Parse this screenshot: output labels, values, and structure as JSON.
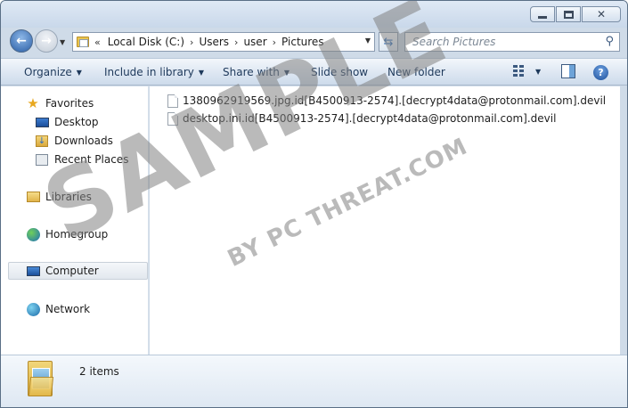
{
  "address": {
    "crumbs": [
      "Local Disk (C:)",
      "Users",
      "user",
      "Pictures"
    ],
    "overflow_glyph": "«"
  },
  "search": {
    "placeholder": "Search Pictures"
  },
  "toolbar": {
    "organize": "Organize",
    "include_in_library": "Include in library",
    "share_with": "Share with",
    "slide_show": "Slide show",
    "new_folder": "New folder"
  },
  "nav": {
    "favorites": "Favorites",
    "desktop": "Desktop",
    "downloads": "Downloads",
    "recent_places": "Recent Places",
    "libraries": "Libraries",
    "homegroup": "Homegroup",
    "computer": "Computer",
    "network": "Network"
  },
  "files": [
    {
      "name": "1380962919569.jpg.id[B4500913-2574].[decrypt4data@protonmail.com].devil"
    },
    {
      "name": "desktop.ini.id[B4500913-2574].[decrypt4data@protonmail.com].devil"
    }
  ],
  "status": {
    "item_count": "2 items"
  },
  "watermark": {
    "main": "SAMPLE",
    "sub": "BY PC THREAT.COM"
  },
  "colors": {
    "accent": "#1e395b",
    "chrome": "#cfdbe8",
    "selection": "#e3e8ee"
  }
}
